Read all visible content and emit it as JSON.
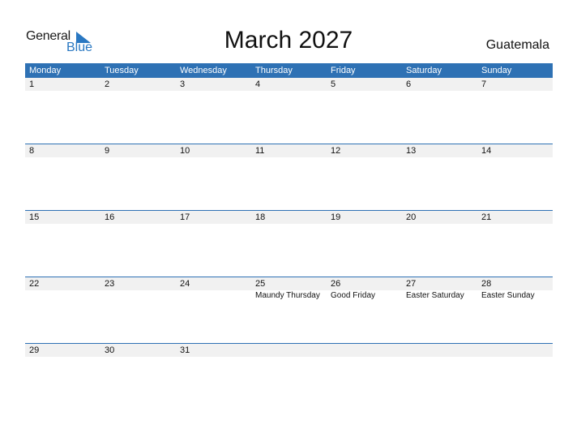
{
  "logo": {
    "general": "General",
    "blue": "Blue"
  },
  "title": "March 2027",
  "country": "Guatemala",
  "weekdays": [
    "Monday",
    "Tuesday",
    "Wednesday",
    "Thursday",
    "Friday",
    "Saturday",
    "Sunday"
  ],
  "weeks": [
    {
      "days": [
        "1",
        "2",
        "3",
        "4",
        "5",
        "6",
        "7"
      ],
      "events": [
        "",
        "",
        "",
        "",
        "",
        "",
        ""
      ]
    },
    {
      "days": [
        "8",
        "9",
        "10",
        "11",
        "12",
        "13",
        "14"
      ],
      "events": [
        "",
        "",
        "",
        "",
        "",
        "",
        ""
      ]
    },
    {
      "days": [
        "15",
        "16",
        "17",
        "18",
        "19",
        "20",
        "21"
      ],
      "events": [
        "",
        "",
        "",
        "",
        "",
        "",
        ""
      ]
    },
    {
      "days": [
        "22",
        "23",
        "24",
        "25",
        "26",
        "27",
        "28"
      ],
      "events": [
        "",
        "",
        "",
        "Maundy Thursday",
        "Good Friday",
        "Easter Saturday",
        "Easter Sunday"
      ]
    },
    {
      "days": [
        "29",
        "30",
        "31",
        "",
        "",
        "",
        ""
      ],
      "events": [
        "",
        "",
        "",
        "",
        "",
        "",
        ""
      ]
    }
  ],
  "colors": {
    "header_bg": "#2e71b4",
    "brand_blue": "#2a78c2",
    "day_row_bg": "#f1f1f1"
  }
}
